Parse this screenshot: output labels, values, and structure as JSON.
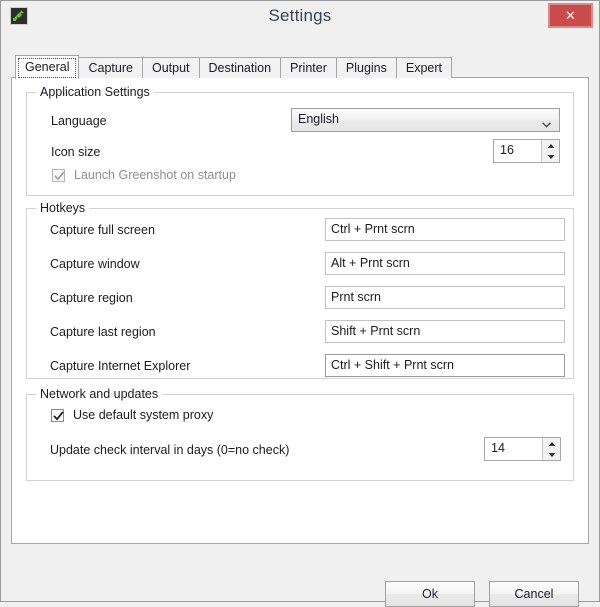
{
  "window": {
    "title": "Settings",
    "app_icon": "greenshot-icon",
    "close_label": "✕",
    "accent_close_color": "#c94b4b"
  },
  "tabs": [
    {
      "label": "General",
      "selected": true
    },
    {
      "label": "Capture",
      "selected": false
    },
    {
      "label": "Output",
      "selected": false
    },
    {
      "label": "Destination",
      "selected": false
    },
    {
      "label": "Printer",
      "selected": false
    },
    {
      "label": "Plugins",
      "selected": false
    },
    {
      "label": "Expert",
      "selected": false
    }
  ],
  "application_settings": {
    "group_title": "Application Settings",
    "language": {
      "label": "Language",
      "value": "English"
    },
    "icon_size": {
      "label": "Icon size",
      "value": "16"
    },
    "launch_on_startup": {
      "label": "Launch Greenshot on startup",
      "checked": true,
      "enabled": false
    }
  },
  "hotkeys": {
    "group_title": "Hotkeys",
    "items": [
      {
        "label": "Capture full screen",
        "value": "Ctrl + Prnt scrn",
        "focused": false
      },
      {
        "label": "Capture window",
        "value": "Alt + Prnt scrn",
        "focused": false
      },
      {
        "label": "Capture region",
        "value": "Prnt scrn",
        "focused": false
      },
      {
        "label": "Capture last region",
        "value": "Shift + Prnt scrn",
        "focused": false
      },
      {
        "label": "Capture Internet Explorer",
        "value": "Ctrl + Shift + Prnt scrn",
        "focused": true
      }
    ]
  },
  "network_and_updates": {
    "group_title": "Network and updates",
    "use_default_proxy": {
      "label": "Use default system proxy",
      "checked": true,
      "enabled": true
    },
    "update_interval": {
      "label": "Update check interval in days (0=no check)",
      "value": "14"
    }
  },
  "footer": {
    "ok_label": "Ok",
    "cancel_label": "Cancel"
  }
}
